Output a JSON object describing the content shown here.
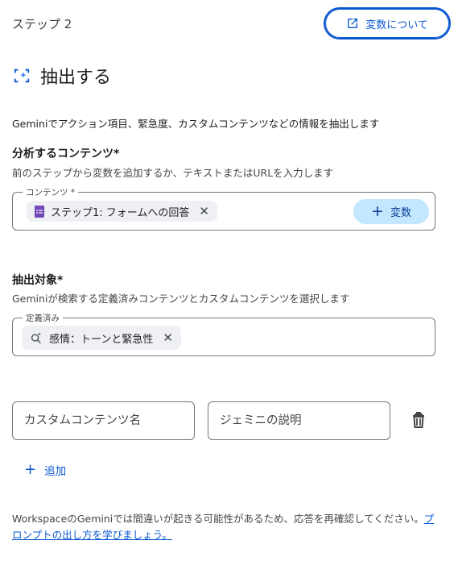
{
  "header": {
    "step_label": "ステップ 2",
    "about_button_label": "変数について"
  },
  "title": {
    "text": "抽出する",
    "icon": "sparkle-frame-icon"
  },
  "description": "Geminiでアクション項目、緊急度、カスタムコンテンツなどの情報を抽出します",
  "content_section": {
    "title": "分析するコンテンツ*",
    "subtitle": "前のステップから変数を追加するか、テキストまたはURLを入力します",
    "field_legend": "コンテンツ *",
    "chip_label": "ステップ1: フォームへの回答",
    "chip_icon": "forms-icon",
    "variable_button_label": "変数"
  },
  "extract_section": {
    "title": "抽出対象*",
    "subtitle": "Geminiが検索する定義済みコンテンツとカスタムコンテンツを選択します",
    "field_legend": "定義済み",
    "chip_label": "感情：トーンと緊急性",
    "chip_icon": "sentiment-search-icon"
  },
  "custom_row": {
    "name_placeholder": "カスタムコンテンツ名",
    "description_placeholder": "ジェミニの説明"
  },
  "add_label": "追加",
  "footer": {
    "text": "WorkspaceのGeminiでは間違いが起きる可能性があるため、応答を再確認してください。",
    "link": "プロンプトの出し方を学びましょう。"
  },
  "colors": {
    "accent": "#0b57d0",
    "chip_bg": "#eef0f4",
    "variable_button_bg": "#c2e7ff",
    "forms_purple": "#7248b9"
  }
}
